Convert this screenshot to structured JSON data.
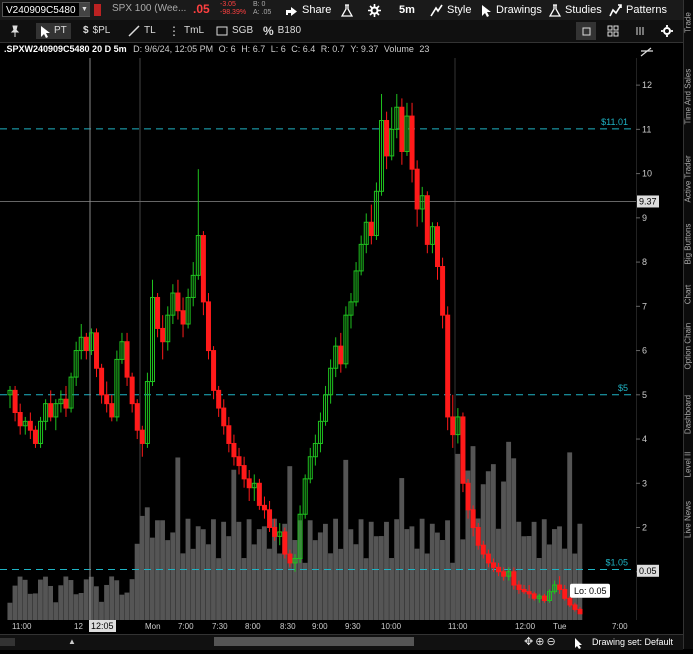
{
  "header": {
    "symbol": "V240909C5480",
    "description": "SPX 100 (Wee...",
    "last": ".05",
    "change": "-3.05",
    "change_pct": "-98.39%",
    "bid": "B: 0",
    "ask": "A: .05",
    "share_label": "Share",
    "timeframe_label": "5m",
    "style_label": "Style",
    "drawings_label": "Drawings",
    "studies_label": "Studies",
    "patterns_label": "Patterns"
  },
  "toolbar": {
    "pt_label": "PT",
    "pl_label": "$PL",
    "tl_label": "TL",
    "tml_label": "TmL",
    "sgb_label": "SGB",
    "b180_label": "B180"
  },
  "infobar": {
    "symbol": ".SPXW240909C5480 20 D 5m",
    "date": "D: 9/6/24, 12:05 PM",
    "open": "O: 6",
    "high": "H: 6.7",
    "low": "L: 6",
    "close": "C: 6.4",
    "range": "R: 0.7",
    "y": "Y: 9.37",
    "volume_label": "Volume",
    "volume": "23"
  },
  "price_axis": {
    "ticks": [
      "12",
      "11",
      "10",
      "9",
      "8",
      "7",
      "6",
      "5",
      "4",
      "3",
      "2",
      "1"
    ],
    "cursor_price": "9.37",
    "last_price": "0.05"
  },
  "levels": [
    {
      "label": "$11.01",
      "value": 11.01
    },
    {
      "label": "$5",
      "value": 5
    },
    {
      "label": "$1.05",
      "value": 1.05
    }
  ],
  "low_label": "Lo: 0.05",
  "time_axis": {
    "ticks": [
      "11:00",
      "12",
      "Mon",
      "7:00",
      "7:30",
      "8:00",
      "8:30",
      "9:00",
      "9:30",
      "10:00",
      "11:00",
      "12:00",
      "Tue",
      "7:00"
    ],
    "cursor_time": "12:05"
  },
  "sidebar_tabs": [
    "Trade",
    "Time And Sales",
    "Active Trader",
    "Big Buttons",
    "Chart",
    "Option Chain",
    "Dashboard",
    "Level II",
    "Live News"
  ],
  "status": {
    "drawing_set": "Drawing set: Default"
  },
  "colors": {
    "up": "#1fc21f",
    "down": "#ff1a1a",
    "level": "#1fb3c4",
    "volume": "#555555"
  },
  "chart_data": {
    "type": "candlestick",
    "ylim": [
      0,
      12.5
    ],
    "candles": [
      [
        5.0,
        5.2,
        4.7,
        5.1
      ],
      [
        5.1,
        5.2,
        4.4,
        4.6
      ],
      [
        4.6,
        4.8,
        4.1,
        4.3
      ],
      [
        4.3,
        4.5,
        4.1,
        4.4
      ],
      [
        4.4,
        4.6,
        4.0,
        4.2
      ],
      [
        4.2,
        4.3,
        3.8,
        3.9
      ],
      [
        3.9,
        4.5,
        3.8,
        4.4
      ],
      [
        4.4,
        4.9,
        4.2,
        4.8
      ],
      [
        4.8,
        5.1,
        4.4,
        4.5
      ],
      [
        4.5,
        4.9,
        4.2,
        4.8
      ],
      [
        4.8,
        5.1,
        4.6,
        4.9
      ],
      [
        4.9,
        5.2,
        4.5,
        4.7
      ],
      [
        4.7,
        5.5,
        4.6,
        5.4
      ],
      [
        5.4,
        6.2,
        5.2,
        6.0
      ],
      [
        6.0,
        6.6,
        5.8,
        6.3
      ],
      [
        6.3,
        6.4,
        5.8,
        6.0
      ],
      [
        6.0,
        6.5,
        5.9,
        6.4
      ],
      [
        6.4,
        6.5,
        5.4,
        5.6
      ],
      [
        5.6,
        5.7,
        4.8,
        5.0
      ],
      [
        5.0,
        5.3,
        4.6,
        4.8
      ],
      [
        4.8,
        5.0,
        4.4,
        4.5
      ],
      [
        4.5,
        6.0,
        4.4,
        5.8
      ],
      [
        5.8,
        6.4,
        5.7,
        6.2
      ],
      [
        6.2,
        6.4,
        5.2,
        5.4
      ],
      [
        5.4,
        5.5,
        4.6,
        4.8
      ],
      [
        4.8,
        4.9,
        4.0,
        4.2
      ],
      [
        4.2,
        4.3,
        3.6,
        3.9
      ],
      [
        3.9,
        5.5,
        3.8,
        5.3
      ],
      [
        5.3,
        7.6,
        5.2,
        7.2
      ],
      [
        7.2,
        7.3,
        6.3,
        6.5
      ],
      [
        6.5,
        6.8,
        5.8,
        6.2
      ],
      [
        6.2,
        7.0,
        6.0,
        6.8
      ],
      [
        6.8,
        7.5,
        6.6,
        7.3
      ],
      [
        7.3,
        7.6,
        6.7,
        6.9
      ],
      [
        6.9,
        7.2,
        6.3,
        6.6
      ],
      [
        6.6,
        7.4,
        6.5,
        7.2
      ],
      [
        7.2,
        8.0,
        7.0,
        7.7
      ],
      [
        7.7,
        10.1,
        7.6,
        8.6
      ],
      [
        8.6,
        8.7,
        6.8,
        7.1
      ],
      [
        7.1,
        7.3,
        5.8,
        6.0
      ],
      [
        6.0,
        6.1,
        4.9,
        5.1
      ],
      [
        5.1,
        5.2,
        4.5,
        4.7
      ],
      [
        4.7,
        4.9,
        4.1,
        4.3
      ],
      [
        4.3,
        4.5,
        3.7,
        3.9
      ],
      [
        3.9,
        4.1,
        3.4,
        3.6
      ],
      [
        3.6,
        3.8,
        3.2,
        3.4
      ],
      [
        3.4,
        3.6,
        2.9,
        3.1
      ],
      [
        3.1,
        3.3,
        2.6,
        2.9
      ],
      [
        2.9,
        3.2,
        2.6,
        3.0
      ],
      [
        3.0,
        3.1,
        2.4,
        2.5
      ],
      [
        2.5,
        2.7,
        2.2,
        2.4
      ],
      [
        2.4,
        2.6,
        1.9,
        2.0
      ],
      [
        2.0,
        2.2,
        1.7,
        1.8
      ],
      [
        1.8,
        2.1,
        1.6,
        1.9
      ],
      [
        1.9,
        2.0,
        1.3,
        1.4
      ],
      [
        1.4,
        1.5,
        1.1,
        1.2
      ],
      [
        1.2,
        1.4,
        1.0,
        1.3
      ],
      [
        1.3,
        2.5,
        1.2,
        2.3
      ],
      [
        2.3,
        3.2,
        2.2,
        3.1
      ],
      [
        3.1,
        3.8,
        3.0,
        3.6
      ],
      [
        3.6,
        4.1,
        3.4,
        3.9
      ],
      [
        3.9,
        4.6,
        3.7,
        4.4
      ],
      [
        4.4,
        5.2,
        4.3,
        5.0
      ],
      [
        5.0,
        5.8,
        4.8,
        5.6
      ],
      [
        5.6,
        6.3,
        5.4,
        6.1
      ],
      [
        6.1,
        6.4,
        5.5,
        5.7
      ],
      [
        5.7,
        7.0,
        5.6,
        6.8
      ],
      [
        6.8,
        7.3,
        6.5,
        7.1
      ],
      [
        7.1,
        8.0,
        7.0,
        7.8
      ],
      [
        7.8,
        8.6,
        7.7,
        8.4
      ],
      [
        8.4,
        9.1,
        8.2,
        8.9
      ],
      [
        8.9,
        9.3,
        8.4,
        8.6
      ],
      [
        8.6,
        9.8,
        8.5,
        9.6
      ],
      [
        9.6,
        11.8,
        9.5,
        11.2
      ],
      [
        11.2,
        11.4,
        10.1,
        10.4
      ],
      [
        10.4,
        11.5,
        10.3,
        11.0
      ],
      [
        11.0,
        11.8,
        10.8,
        11.5
      ],
      [
        11.5,
        11.7,
        10.2,
        10.5
      ],
      [
        10.5,
        11.6,
        10.4,
        11.3
      ],
      [
        11.3,
        11.6,
        9.8,
        10.1
      ],
      [
        10.1,
        10.3,
        8.8,
        9.2
      ],
      [
        9.2,
        9.7,
        8.9,
        9.5
      ],
      [
        9.5,
        9.6,
        8.2,
        8.4
      ],
      [
        8.4,
        8.9,
        8.2,
        8.8
      ],
      [
        8.8,
        8.9,
        7.6,
        7.9
      ],
      [
        7.9,
        8.1,
        6.5,
        6.8
      ],
      [
        6.8,
        7.0,
        4.2,
        4.5
      ],
      [
        4.5,
        5.0,
        3.8,
        4.1
      ],
      [
        4.1,
        4.7,
        3.9,
        4.5
      ],
      [
        4.5,
        4.6,
        2.8,
        3.0
      ],
      [
        3.0,
        3.1,
        2.2,
        2.4
      ],
      [
        2.4,
        2.5,
        1.8,
        2.0
      ],
      [
        2.0,
        2.1,
        1.5,
        1.6
      ],
      [
        1.6,
        1.7,
        1.3,
        1.4
      ],
      [
        1.4,
        1.5,
        1.1,
        1.2
      ],
      [
        1.2,
        1.3,
        1.0,
        1.1
      ],
      [
        1.1,
        1.2,
        0.9,
        1.0
      ],
      [
        1.0,
        1.1,
        0.8,
        0.9
      ],
      [
        0.9,
        1.1,
        0.8,
        1.0
      ],
      [
        1.0,
        1.1,
        0.6,
        0.7
      ],
      [
        0.7,
        0.8,
        0.5,
        0.6
      ],
      [
        0.6,
        0.7,
        0.5,
        0.55
      ],
      [
        0.55,
        0.7,
        0.4,
        0.5
      ],
      [
        0.5,
        0.55,
        0.35,
        0.4
      ],
      [
        0.4,
        0.5,
        0.3,
        0.45
      ],
      [
        0.45,
        0.5,
        0.3,
        0.35
      ],
      [
        0.35,
        0.6,
        0.3,
        0.55
      ],
      [
        0.55,
        0.8,
        0.5,
        0.7
      ],
      [
        0.7,
        0.9,
        0.5,
        0.6
      ],
      [
        0.6,
        0.7,
        0.35,
        0.4
      ],
      [
        0.4,
        0.45,
        0.2,
        0.25
      ],
      [
        0.25,
        0.3,
        0.1,
        0.15
      ],
      [
        0.15,
        0.2,
        0.05,
        0.05
      ]
    ],
    "volume": [
      1,
      1,
      1,
      1,
      1,
      1,
      1,
      1,
      1,
      1,
      1,
      1,
      1,
      1,
      1,
      1,
      1,
      1,
      1,
      1,
      1,
      1,
      1,
      1,
      1,
      1,
      1,
      1,
      1,
      1,
      1,
      1,
      1,
      1,
      1,
      1,
      1,
      1,
      1,
      1,
      1,
      1,
      1,
      1,
      1,
      1,
      1,
      1,
      1,
      1,
      1,
      1,
      1,
      1,
      1,
      1,
      1,
      1,
      1,
      1,
      1,
      1,
      1,
      1,
      1,
      1,
      1,
      1,
      1,
      1,
      1,
      1,
      1,
      1,
      1,
      1,
      1,
      1,
      1,
      1,
      1,
      1,
      1,
      1,
      1,
      1,
      1,
      1,
      1,
      1,
      1,
      1,
      1,
      1,
      1,
      1,
      1,
      1,
      1,
      1,
      1,
      1,
      1,
      1,
      1,
      1,
      1,
      1,
      1,
      1,
      1,
      1,
      1
    ]
  }
}
